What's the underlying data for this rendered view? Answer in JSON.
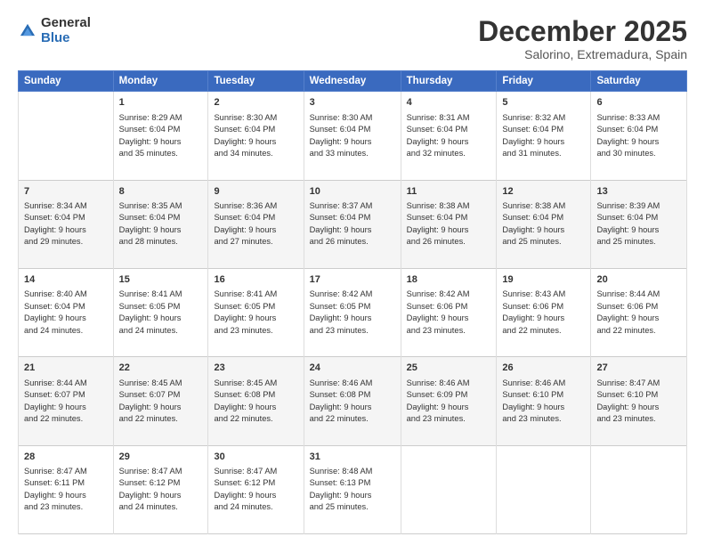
{
  "logo": {
    "general": "General",
    "blue": "Blue"
  },
  "title": "December 2025",
  "subtitle": "Salorino, Extremadura, Spain",
  "headers": [
    "Sunday",
    "Monday",
    "Tuesday",
    "Wednesday",
    "Thursday",
    "Friday",
    "Saturday"
  ],
  "weeks": [
    [
      {
        "day": "",
        "text": ""
      },
      {
        "day": "1",
        "text": "Sunrise: 8:29 AM\nSunset: 6:04 PM\nDaylight: 9 hours\nand 35 minutes."
      },
      {
        "day": "2",
        "text": "Sunrise: 8:30 AM\nSunset: 6:04 PM\nDaylight: 9 hours\nand 34 minutes."
      },
      {
        "day": "3",
        "text": "Sunrise: 8:30 AM\nSunset: 6:04 PM\nDaylight: 9 hours\nand 33 minutes."
      },
      {
        "day": "4",
        "text": "Sunrise: 8:31 AM\nSunset: 6:04 PM\nDaylight: 9 hours\nand 32 minutes."
      },
      {
        "day": "5",
        "text": "Sunrise: 8:32 AM\nSunset: 6:04 PM\nDaylight: 9 hours\nand 31 minutes."
      },
      {
        "day": "6",
        "text": "Sunrise: 8:33 AM\nSunset: 6:04 PM\nDaylight: 9 hours\nand 30 minutes."
      }
    ],
    [
      {
        "day": "7",
        "text": "Sunrise: 8:34 AM\nSunset: 6:04 PM\nDaylight: 9 hours\nand 29 minutes."
      },
      {
        "day": "8",
        "text": "Sunrise: 8:35 AM\nSunset: 6:04 PM\nDaylight: 9 hours\nand 28 minutes."
      },
      {
        "day": "9",
        "text": "Sunrise: 8:36 AM\nSunset: 6:04 PM\nDaylight: 9 hours\nand 27 minutes."
      },
      {
        "day": "10",
        "text": "Sunrise: 8:37 AM\nSunset: 6:04 PM\nDaylight: 9 hours\nand 26 minutes."
      },
      {
        "day": "11",
        "text": "Sunrise: 8:38 AM\nSunset: 6:04 PM\nDaylight: 9 hours\nand 26 minutes."
      },
      {
        "day": "12",
        "text": "Sunrise: 8:38 AM\nSunset: 6:04 PM\nDaylight: 9 hours\nand 25 minutes."
      },
      {
        "day": "13",
        "text": "Sunrise: 8:39 AM\nSunset: 6:04 PM\nDaylight: 9 hours\nand 25 minutes."
      }
    ],
    [
      {
        "day": "14",
        "text": "Sunrise: 8:40 AM\nSunset: 6:04 PM\nDaylight: 9 hours\nand 24 minutes."
      },
      {
        "day": "15",
        "text": "Sunrise: 8:41 AM\nSunset: 6:05 PM\nDaylight: 9 hours\nand 24 minutes."
      },
      {
        "day": "16",
        "text": "Sunrise: 8:41 AM\nSunset: 6:05 PM\nDaylight: 9 hours\nand 23 minutes."
      },
      {
        "day": "17",
        "text": "Sunrise: 8:42 AM\nSunset: 6:05 PM\nDaylight: 9 hours\nand 23 minutes."
      },
      {
        "day": "18",
        "text": "Sunrise: 8:42 AM\nSunset: 6:06 PM\nDaylight: 9 hours\nand 23 minutes."
      },
      {
        "day": "19",
        "text": "Sunrise: 8:43 AM\nSunset: 6:06 PM\nDaylight: 9 hours\nand 22 minutes."
      },
      {
        "day": "20",
        "text": "Sunrise: 8:44 AM\nSunset: 6:06 PM\nDaylight: 9 hours\nand 22 minutes."
      }
    ],
    [
      {
        "day": "21",
        "text": "Sunrise: 8:44 AM\nSunset: 6:07 PM\nDaylight: 9 hours\nand 22 minutes."
      },
      {
        "day": "22",
        "text": "Sunrise: 8:45 AM\nSunset: 6:07 PM\nDaylight: 9 hours\nand 22 minutes."
      },
      {
        "day": "23",
        "text": "Sunrise: 8:45 AM\nSunset: 6:08 PM\nDaylight: 9 hours\nand 22 minutes."
      },
      {
        "day": "24",
        "text": "Sunrise: 8:46 AM\nSunset: 6:08 PM\nDaylight: 9 hours\nand 22 minutes."
      },
      {
        "day": "25",
        "text": "Sunrise: 8:46 AM\nSunset: 6:09 PM\nDaylight: 9 hours\nand 23 minutes."
      },
      {
        "day": "26",
        "text": "Sunrise: 8:46 AM\nSunset: 6:10 PM\nDaylight: 9 hours\nand 23 minutes."
      },
      {
        "day": "27",
        "text": "Sunrise: 8:47 AM\nSunset: 6:10 PM\nDaylight: 9 hours\nand 23 minutes."
      }
    ],
    [
      {
        "day": "28",
        "text": "Sunrise: 8:47 AM\nSunset: 6:11 PM\nDaylight: 9 hours\nand 23 minutes."
      },
      {
        "day": "29",
        "text": "Sunrise: 8:47 AM\nSunset: 6:12 PM\nDaylight: 9 hours\nand 24 minutes."
      },
      {
        "day": "30",
        "text": "Sunrise: 8:47 AM\nSunset: 6:12 PM\nDaylight: 9 hours\nand 24 minutes."
      },
      {
        "day": "31",
        "text": "Sunrise: 8:48 AM\nSunset: 6:13 PM\nDaylight: 9 hours\nand 25 minutes."
      },
      {
        "day": "",
        "text": ""
      },
      {
        "day": "",
        "text": ""
      },
      {
        "day": "",
        "text": ""
      }
    ]
  ]
}
